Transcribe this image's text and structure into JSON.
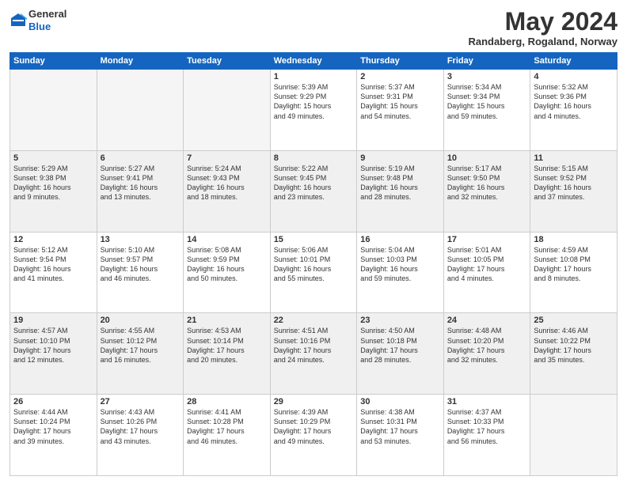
{
  "header": {
    "logo_line1": "General",
    "logo_line2": "Blue",
    "month": "May 2024",
    "location": "Randaberg, Rogaland, Norway"
  },
  "days_of_week": [
    "Sunday",
    "Monday",
    "Tuesday",
    "Wednesday",
    "Thursday",
    "Friday",
    "Saturday"
  ],
  "weeks": [
    {
      "shaded": false,
      "days": [
        {
          "num": "",
          "info": ""
        },
        {
          "num": "",
          "info": ""
        },
        {
          "num": "",
          "info": ""
        },
        {
          "num": "1",
          "info": "Sunrise: 5:39 AM\nSunset: 9:29 PM\nDaylight: 15 hours\nand 49 minutes."
        },
        {
          "num": "2",
          "info": "Sunrise: 5:37 AM\nSunset: 9:31 PM\nDaylight: 15 hours\nand 54 minutes."
        },
        {
          "num": "3",
          "info": "Sunrise: 5:34 AM\nSunset: 9:34 PM\nDaylight: 15 hours\nand 59 minutes."
        },
        {
          "num": "4",
          "info": "Sunrise: 5:32 AM\nSunset: 9:36 PM\nDaylight: 16 hours\nand 4 minutes."
        }
      ]
    },
    {
      "shaded": true,
      "days": [
        {
          "num": "5",
          "info": "Sunrise: 5:29 AM\nSunset: 9:38 PM\nDaylight: 16 hours\nand 9 minutes."
        },
        {
          "num": "6",
          "info": "Sunrise: 5:27 AM\nSunset: 9:41 PM\nDaylight: 16 hours\nand 13 minutes."
        },
        {
          "num": "7",
          "info": "Sunrise: 5:24 AM\nSunset: 9:43 PM\nDaylight: 16 hours\nand 18 minutes."
        },
        {
          "num": "8",
          "info": "Sunrise: 5:22 AM\nSunset: 9:45 PM\nDaylight: 16 hours\nand 23 minutes."
        },
        {
          "num": "9",
          "info": "Sunrise: 5:19 AM\nSunset: 9:48 PM\nDaylight: 16 hours\nand 28 minutes."
        },
        {
          "num": "10",
          "info": "Sunrise: 5:17 AM\nSunset: 9:50 PM\nDaylight: 16 hours\nand 32 minutes."
        },
        {
          "num": "11",
          "info": "Sunrise: 5:15 AM\nSunset: 9:52 PM\nDaylight: 16 hours\nand 37 minutes."
        }
      ]
    },
    {
      "shaded": false,
      "days": [
        {
          "num": "12",
          "info": "Sunrise: 5:12 AM\nSunset: 9:54 PM\nDaylight: 16 hours\nand 41 minutes."
        },
        {
          "num": "13",
          "info": "Sunrise: 5:10 AM\nSunset: 9:57 PM\nDaylight: 16 hours\nand 46 minutes."
        },
        {
          "num": "14",
          "info": "Sunrise: 5:08 AM\nSunset: 9:59 PM\nDaylight: 16 hours\nand 50 minutes."
        },
        {
          "num": "15",
          "info": "Sunrise: 5:06 AM\nSunset: 10:01 PM\nDaylight: 16 hours\nand 55 minutes."
        },
        {
          "num": "16",
          "info": "Sunrise: 5:04 AM\nSunset: 10:03 PM\nDaylight: 16 hours\nand 59 minutes."
        },
        {
          "num": "17",
          "info": "Sunrise: 5:01 AM\nSunset: 10:05 PM\nDaylight: 17 hours\nand 4 minutes."
        },
        {
          "num": "18",
          "info": "Sunrise: 4:59 AM\nSunset: 10:08 PM\nDaylight: 17 hours\nand 8 minutes."
        }
      ]
    },
    {
      "shaded": true,
      "days": [
        {
          "num": "19",
          "info": "Sunrise: 4:57 AM\nSunset: 10:10 PM\nDaylight: 17 hours\nand 12 minutes."
        },
        {
          "num": "20",
          "info": "Sunrise: 4:55 AM\nSunset: 10:12 PM\nDaylight: 17 hours\nand 16 minutes."
        },
        {
          "num": "21",
          "info": "Sunrise: 4:53 AM\nSunset: 10:14 PM\nDaylight: 17 hours\nand 20 minutes."
        },
        {
          "num": "22",
          "info": "Sunrise: 4:51 AM\nSunset: 10:16 PM\nDaylight: 17 hours\nand 24 minutes."
        },
        {
          "num": "23",
          "info": "Sunrise: 4:50 AM\nSunset: 10:18 PM\nDaylight: 17 hours\nand 28 minutes."
        },
        {
          "num": "24",
          "info": "Sunrise: 4:48 AM\nSunset: 10:20 PM\nDaylight: 17 hours\nand 32 minutes."
        },
        {
          "num": "25",
          "info": "Sunrise: 4:46 AM\nSunset: 10:22 PM\nDaylight: 17 hours\nand 35 minutes."
        }
      ]
    },
    {
      "shaded": false,
      "days": [
        {
          "num": "26",
          "info": "Sunrise: 4:44 AM\nSunset: 10:24 PM\nDaylight: 17 hours\nand 39 minutes."
        },
        {
          "num": "27",
          "info": "Sunrise: 4:43 AM\nSunset: 10:26 PM\nDaylight: 17 hours\nand 43 minutes."
        },
        {
          "num": "28",
          "info": "Sunrise: 4:41 AM\nSunset: 10:28 PM\nDaylight: 17 hours\nand 46 minutes."
        },
        {
          "num": "29",
          "info": "Sunrise: 4:39 AM\nSunset: 10:29 PM\nDaylight: 17 hours\nand 49 minutes."
        },
        {
          "num": "30",
          "info": "Sunrise: 4:38 AM\nSunset: 10:31 PM\nDaylight: 17 hours\nand 53 minutes."
        },
        {
          "num": "31",
          "info": "Sunrise: 4:37 AM\nSunset: 10:33 PM\nDaylight: 17 hours\nand 56 minutes."
        },
        {
          "num": "",
          "info": ""
        }
      ]
    }
  ]
}
